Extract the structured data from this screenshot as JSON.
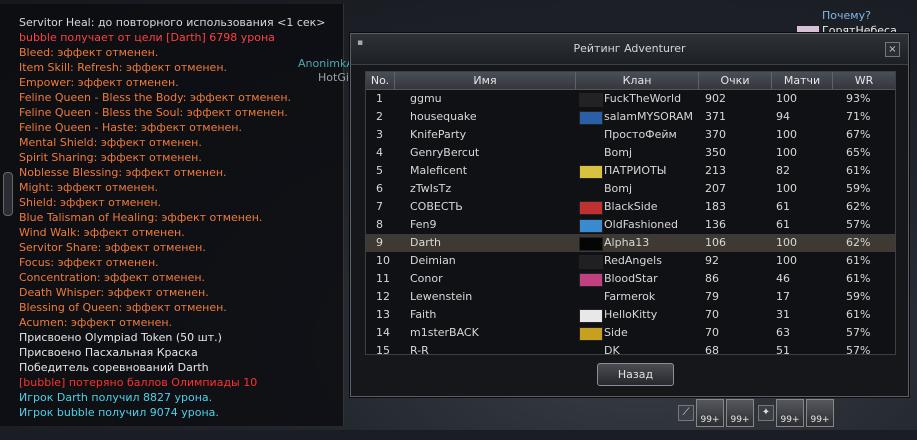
{
  "chat": {
    "lines": [
      {
        "text": "Servitor Heal: до повторного использования <1 сек>",
        "color": "#d8d8d8"
      },
      {
        "text": "bubble получает от цели [Darth] 6798 урона",
        "color": "#ff4040"
      },
      {
        "text": "Bleed: эффект отменен.",
        "color": "#f07a3a"
      },
      {
        "text": "Item Skill: Refresh: эффект отменен.",
        "color": "#f07a3a"
      },
      {
        "text": "Empower: эффект отменен.",
        "color": "#f07a3a"
      },
      {
        "text": "Feline Queen - Bless the Body: эффект отменен.",
        "color": "#f07a3a"
      },
      {
        "text": "Feline Queen - Bless the Soul: эффект отменен.",
        "color": "#f07a3a"
      },
      {
        "text": "Feline Queen - Haste: эффект отменен.",
        "color": "#f07a3a"
      },
      {
        "text": "Mental Shield: эффект отменен.",
        "color": "#f07a3a"
      },
      {
        "text": "Spirit Sharing: эффект отменен.",
        "color": "#f07a3a"
      },
      {
        "text": "Noblesse Blessing: эффект отменен.",
        "color": "#f07a3a"
      },
      {
        "text": "Might: эффект отменен.",
        "color": "#f07a3a"
      },
      {
        "text": "Shield: эффект отменен.",
        "color": "#f07a3a"
      },
      {
        "text": "Blue Talisman of Healing: эффект отменен.",
        "color": "#f07a3a"
      },
      {
        "text": "Wind Walk: эффект отменен.",
        "color": "#f07a3a"
      },
      {
        "text": "Servitor Share: эффект отменен.",
        "color": "#f07a3a"
      },
      {
        "text": "Focus: эффект отменен.",
        "color": "#f07a3a"
      },
      {
        "text": "Concentration: эффект отменен.",
        "color": "#f07a3a"
      },
      {
        "text": "Death Whisper: эффект отменен.",
        "color": "#f07a3a"
      },
      {
        "text": "Blessing of Queen: эффект отменен.",
        "color": "#f07a3a"
      },
      {
        "text": "Acumen: эффект отменен.",
        "color": "#f07a3a"
      },
      {
        "text": "Присвоено Olympiad Token (50 шт.)",
        "color": "#e6e6e6"
      },
      {
        "text": "Присвоено Пасхальная Краска",
        "color": "#e6e6e6"
      },
      {
        "text": "Победитель соревнований Darth",
        "color": "#e6e6e6"
      },
      {
        "text": "[bubble] потеряно баллов Олимпиады 10",
        "color": "#ff3030"
      },
      {
        "text": "Игрок Darth получил 8827 урона.",
        "color": "#4fd0e8"
      },
      {
        "text": "Игрок bubble получил 9074 урона.",
        "color": "#4fd0e8"
      }
    ]
  },
  "overlay": {
    "why": "Почему?",
    "player_name": "ГорятНебеса",
    "anon_name": "AnonimkA",
    "hotgirl_name": "HotGirl"
  },
  "ranking": {
    "title": "Рейтинг Adventurer",
    "close_glyph": "×",
    "headers": {
      "no": "No.",
      "name": "Имя",
      "clan": "Клан",
      "points": "Очки",
      "matches": "Матчи",
      "wr": "WR"
    },
    "rows": [
      {
        "no": "1",
        "name": "ggmu",
        "clan": "FuckTheWorld",
        "points": "902",
        "matches": "100",
        "wr": "93%",
        "crest": "#222222"
      },
      {
        "no": "2",
        "name": "housequake",
        "clan": "salamMYSORAM",
        "points": "371",
        "matches": "94",
        "wr": "71%",
        "crest": "#2a5fa8"
      },
      {
        "no": "3",
        "name": "KnifeParty",
        "clan": "ПростоФейм",
        "points": "370",
        "matches": "100",
        "wr": "67%",
        "crest": ""
      },
      {
        "no": "4",
        "name": "GenryBercut",
        "clan": "Bomj",
        "points": "350",
        "matches": "100",
        "wr": "65%",
        "crest": ""
      },
      {
        "no": "5",
        "name": "Maleficent",
        "clan": "ПАТРИОТЫ",
        "points": "213",
        "matches": "82",
        "wr": "61%",
        "crest": "#d8c040"
      },
      {
        "no": "6",
        "name": "zTwIsTz",
        "clan": "Bomj",
        "points": "207",
        "matches": "100",
        "wr": "59%",
        "crest": ""
      },
      {
        "no": "7",
        "name": "COBECTЬ",
        "clan": "BlackSide",
        "points": "183",
        "matches": "61",
        "wr": "62%",
        "crest": "#c03030"
      },
      {
        "no": "8",
        "name": "Fen9",
        "clan": "OldFashioned",
        "points": "136",
        "matches": "61",
        "wr": "57%",
        "crest": "#3a8ad0"
      },
      {
        "no": "9",
        "name": "Darth",
        "clan": "Alpha13",
        "points": "106",
        "matches": "100",
        "wr": "62%",
        "crest": "#050505"
      },
      {
        "no": "10",
        "name": "Deimian",
        "clan": "RedAngels",
        "points": "92",
        "matches": "100",
        "wr": "61%",
        "crest": "#202020"
      },
      {
        "no": "11",
        "name": "Conor",
        "clan": "BloodStar",
        "points": "86",
        "matches": "46",
        "wr": "61%",
        "crest": "#c04080"
      },
      {
        "no": "12",
        "name": "Lewenstein",
        "clan": "Farmerok",
        "points": "79",
        "matches": "17",
        "wr": "59%",
        "crest": ""
      },
      {
        "no": "13",
        "name": "Faith",
        "clan": "HelloKitty",
        "points": "70",
        "matches": "31",
        "wr": "61%",
        "crest": "#e8e8e8"
      },
      {
        "no": "14",
        "name": "m1sterBACK",
        "clan": "Side",
        "points": "70",
        "matches": "63",
        "wr": "57%",
        "crest": "#c8a020"
      },
      {
        "no": "15",
        "name": "R-R",
        "clan": "DK",
        "points": "68",
        "matches": "51",
        "wr": "57%",
        "crest": ""
      }
    ],
    "back_label": "Назад"
  },
  "hotbar": {
    "slots": [
      {
        "kind": "small",
        "glyph": "⟋",
        "name": "dagger-icon"
      },
      {
        "kind": "item",
        "count": "99+",
        "name": "arrow-bundle-icon"
      },
      {
        "kind": "item",
        "count": "99+",
        "name": "arrow-bundle-icon"
      },
      {
        "kind": "small",
        "glyph": "✦",
        "name": "shot-icon"
      },
      {
        "kind": "item",
        "count": "99+",
        "name": "sword-icon"
      },
      {
        "kind": "item",
        "count": "99+",
        "name": "arrow-bundle-icon"
      }
    ]
  }
}
